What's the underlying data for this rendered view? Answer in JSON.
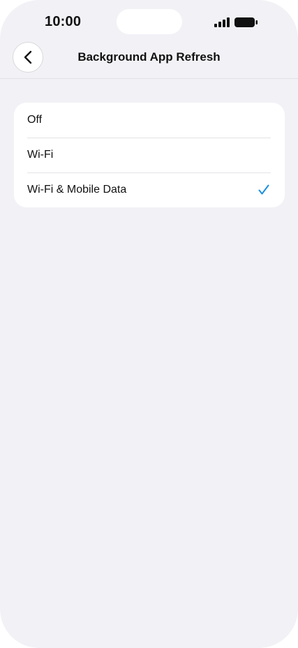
{
  "status_bar": {
    "time": "10:00",
    "signal_icon": "cellular-signal-icon",
    "battery_icon": "battery-icon"
  },
  "nav": {
    "back_icon": "chevron-left-icon",
    "title": "Background App Refresh"
  },
  "options": [
    {
      "label": "Off",
      "selected": false
    },
    {
      "label": "Wi-Fi",
      "selected": false
    },
    {
      "label": "Wi-Fi & Mobile Data",
      "selected": true
    }
  ],
  "colors": {
    "accent": "#1a8fe0",
    "background": "#f2f1f6",
    "card": "#ffffff"
  }
}
